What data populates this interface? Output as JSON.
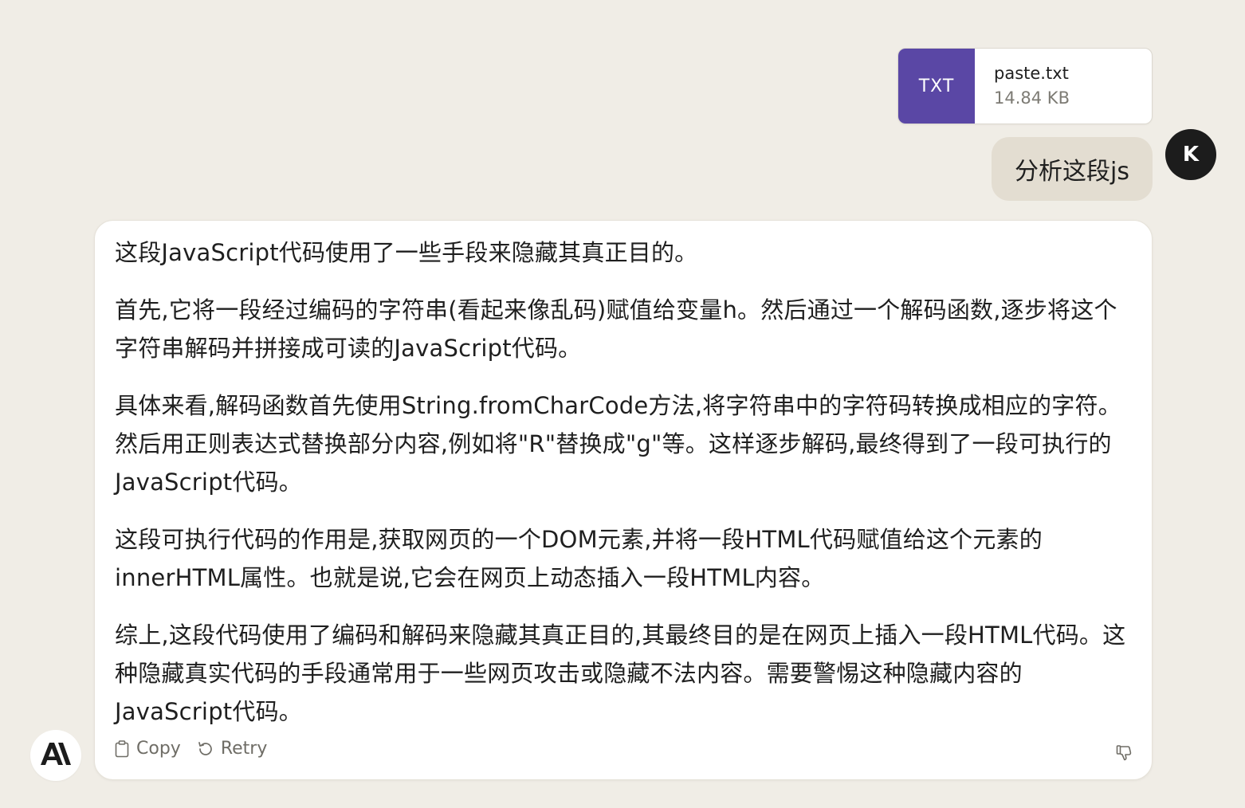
{
  "attachment": {
    "type_label": "TXT",
    "file_name": "paste.txt",
    "file_size": "14.84 KB",
    "type_color": "#5a47a5"
  },
  "user_message": {
    "avatar_initial": "K",
    "text": "分析这段js"
  },
  "assistant_message": {
    "paragraphs": [
      "这段JavaScript代码使用了一些手段来隐藏其真正目的。",
      "首先,它将一段经过编码的字符串(看起来像乱码)赋值给变量h。然后通过一个解码函数,逐步将这个字符串解码并拼接成可读的JavaScript代码。",
      "具体来看,解码函数首先使用String.fromCharCode方法,将字符串中的字符码转换成相应的字符。然后用正则表达式替换部分内容,例如将\"R\"替换成\"g\"等。这样逐步解码,最终得到了一段可执行的JavaScript代码。",
      "这段可执行代码的作用是,获取网页的一个DOM元素,并将一段HTML代码赋值给这个元素的innerHTML属性。也就是说,它会在网页上动态插入一段HTML内容。",
      "综上,这段代码使用了编码和解码来隐藏其真正目的,其最终目的是在网页上插入一段HTML代码。这种隐藏真实代码的手段通常用于一些网页攻击或隐藏不法内容。需要警惕这种隐藏内容的JavaScript代码。"
    ],
    "actions": {
      "copy_label": "Copy",
      "retry_label": "Retry"
    }
  },
  "icons": {
    "copy": "clipboard-icon",
    "retry": "retry-icon",
    "feedback": "thumbs-down-icon",
    "assistant_logo": "anthropic-logo-icon"
  }
}
